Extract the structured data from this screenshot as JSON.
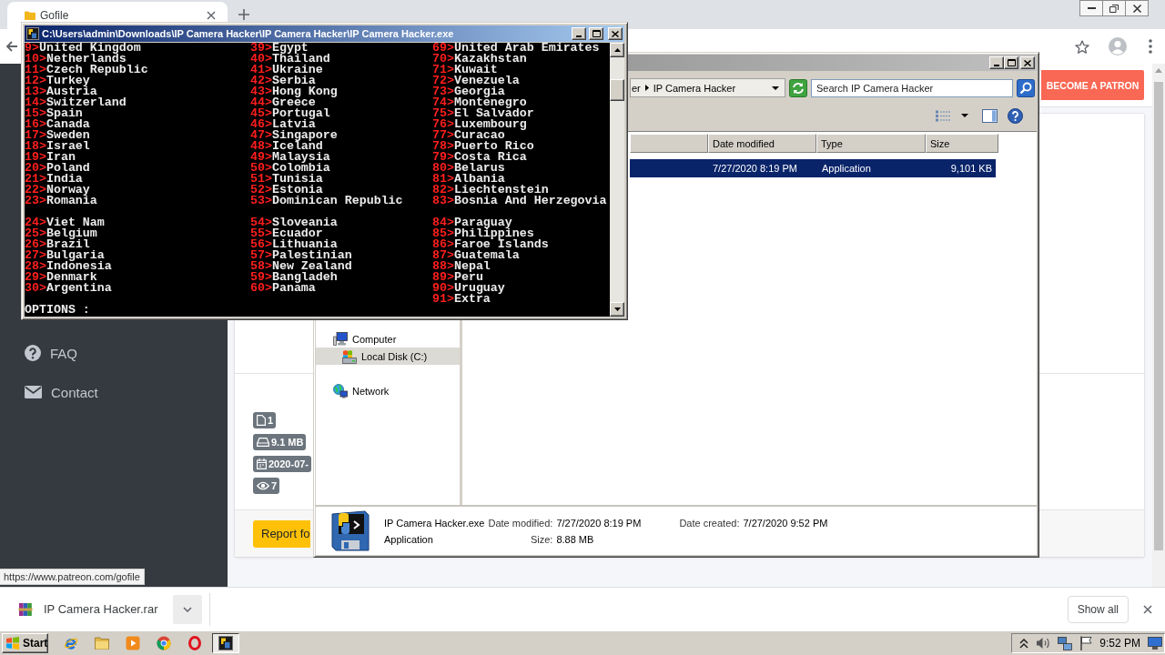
{
  "browser": {
    "tabs": [
      {
        "title": "Gofile",
        "selected": true
      }
    ],
    "sidebar": {
      "items": [
        {
          "kind": "help",
          "label": "FAQ"
        },
        {
          "kind": "mail",
          "label": "Contact"
        }
      ]
    },
    "navbar": {
      "button": "BECOME A PATRON"
    },
    "file_info": {
      "badges": [
        {
          "kind": "files",
          "text": "1"
        },
        {
          "kind": "size",
          "text": "9.1 MB"
        },
        {
          "kind": "date",
          "text": "2020-07-"
        },
        {
          "kind": "views",
          "text": "7"
        }
      ],
      "report_button": "Report fo"
    },
    "status_url": "https://www.patreon.com/gofile",
    "download_bar": {
      "file": "IP Camera Hacker.rar",
      "show_all": "Show all"
    }
  },
  "explorer": {
    "breadcrumb": [
      "er",
      "IP Camera Hacker"
    ],
    "search": {
      "placeholder": "Search IP Camera Hacker"
    },
    "columns": [
      "Date modified",
      "Type",
      "Size"
    ],
    "rows": [
      {
        "selected": true,
        "cells": [
          "7/27/2020 8:19 PM",
          "Application",
          "9,101 KB"
        ]
      }
    ],
    "navigation": [
      {
        "kind": "computer",
        "label": "Computer",
        "selected": false,
        "children": [
          {
            "kind": "disk",
            "label": "Local Disk (C:)",
            "selected": true
          }
        ]
      },
      {
        "kind": "network",
        "label": "Network",
        "selected": false
      }
    ],
    "details": {
      "rows": [
        {
          "title": "IP Camera Hacker.exe",
          "fields": [
            {
              "label": "Date modified:",
              "value": "7/27/2020 8:19 PM"
            },
            {
              "label": "Date created:",
              "value": "7/27/2020 9:52 PM"
            }
          ]
        },
        {
          "title": "Application",
          "fields": [
            {
              "label": "Size:",
              "value": "8.88 MB"
            }
          ]
        }
      ]
    }
  },
  "console": {
    "title": "C:\\Users\\admin\\Downloads\\IP Camera Hacker\\IP Camera Hacker\\IP Camera Hacker.exe",
    "columns": [
      {
        "groups": [
          [
            {
              "key": "9>",
              "label": "United Kingdom"
            },
            {
              "key": "10>",
              "label": "Netherlands"
            },
            {
              "key": "11>",
              "label": "Czech Republic"
            },
            {
              "key": "12>",
              "label": "Turkey"
            },
            {
              "key": "13>",
              "label": "Austria"
            },
            {
              "key": "14>",
              "label": "Switzerland"
            },
            {
              "key": "15>",
              "label": "Spain"
            },
            {
              "key": "16>",
              "label": "Canada"
            },
            {
              "key": "17>",
              "label": "Sweden"
            },
            {
              "key": "18>",
              "label": "Israel"
            },
            {
              "key": "19>",
              "label": "Iran"
            },
            {
              "key": "20>",
              "label": "Poland"
            },
            {
              "key": "21>",
              "label": "India"
            },
            {
              "key": "22>",
              "label": "Norway"
            },
            {
              "key": "23>",
              "label": "Romania"
            }
          ],
          [
            {
              "key": "24>",
              "label": "Viet Nam"
            },
            {
              "key": "25>",
              "label": "Belgium"
            },
            {
              "key": "26>",
              "label": "Brazil"
            },
            {
              "key": "27>",
              "label": "Bulgaria"
            },
            {
              "key": "28>",
              "label": "Indonesia"
            },
            {
              "key": "29>",
              "label": "Denmark"
            },
            {
              "key": "30>",
              "label": "Argentina"
            }
          ]
        ]
      },
      {
        "groups": [
          [
            {
              "key": "39>",
              "label": "Egypt"
            },
            {
              "key": "40>",
              "label": "Thailand"
            },
            {
              "key": "41>",
              "label": "Ukraine"
            },
            {
              "key": "42>",
              "label": "Serbia"
            },
            {
              "key": "43>",
              "label": "Hong Kong"
            },
            {
              "key": "44>",
              "label": "Greece"
            },
            {
              "key": "45>",
              "label": "Portugal"
            },
            {
              "key": "46>",
              "label": "Latvia"
            },
            {
              "key": "47>",
              "label": "Singapore"
            },
            {
              "key": "48>",
              "label": "Iceland"
            },
            {
              "key": "49>",
              "label": "Malaysia"
            },
            {
              "key": "50>",
              "label": "Colombia"
            },
            {
              "key": "51>",
              "label": "Tunisia"
            },
            {
              "key": "52>",
              "label": "Estonia"
            },
            {
              "key": "53>",
              "label": "Dominican Republic"
            }
          ],
          [
            {
              "key": "54>",
              "label": "Sloveania"
            },
            {
              "key": "55>",
              "label": "Ecuador"
            },
            {
              "key": "56>",
              "label": "Lithuania"
            },
            {
              "key": "57>",
              "label": "Palestinian"
            },
            {
              "key": "58>",
              "label": "New Zealand"
            },
            {
              "key": "59>",
              "label": "Bangladeh"
            },
            {
              "key": "60>",
              "label": "Panama"
            }
          ]
        ]
      },
      {
        "groups": [
          [
            {
              "key": "69>",
              "label": "United Arab Emirates"
            },
            {
              "key": "70>",
              "label": "Kazakhstan"
            },
            {
              "key": "71>",
              "label": "Kuwait"
            },
            {
              "key": "72>",
              "label": "Venezuela"
            },
            {
              "key": "73>",
              "label": "Georgia"
            },
            {
              "key": "74>",
              "label": "Montenegro"
            },
            {
              "key": "75>",
              "label": "El Salvador"
            },
            {
              "key": "76>",
              "label": "Luxembourg"
            },
            {
              "key": "77>",
              "label": "Curacao"
            },
            {
              "key": "78>",
              "label": "Puerto Rico"
            },
            {
              "key": "79>",
              "label": "Costa Rica"
            },
            {
              "key": "80>",
              "label": "Belarus"
            },
            {
              "key": "81>",
              "label": "Albania"
            },
            {
              "key": "82>",
              "label": "Liechtenstein"
            },
            {
              "key": "83>",
              "label": "Bosnia And Herzegovia"
            }
          ],
          [
            {
              "key": "84>",
              "label": "Paraguay"
            },
            {
              "key": "85>",
              "label": "Philippines"
            },
            {
              "key": "86>",
              "label": "Faroe Islands"
            },
            {
              "key": "87>",
              "label": "Guatemala"
            },
            {
              "key": "88>",
              "label": "Nepal"
            },
            {
              "key": "89>",
              "label": "Peru"
            },
            {
              "key": "90>",
              "label": "Uruguay"
            },
            {
              "key": "91>",
              "label": "Extra"
            }
          ]
        ]
      }
    ],
    "prompt": "OPTIONS :"
  },
  "taskbar": {
    "start": "Start",
    "apps": [
      {
        "kind": "globe-e",
        "selected": false
      },
      {
        "kind": "folder",
        "selected": false
      },
      {
        "kind": "player",
        "selected": false
      },
      {
        "kind": "wheel",
        "selected": false
      },
      {
        "kind": "ring",
        "selected": false
      },
      {
        "kind": "app",
        "selected": true
      }
    ],
    "clock": "9:52 PM"
  }
}
